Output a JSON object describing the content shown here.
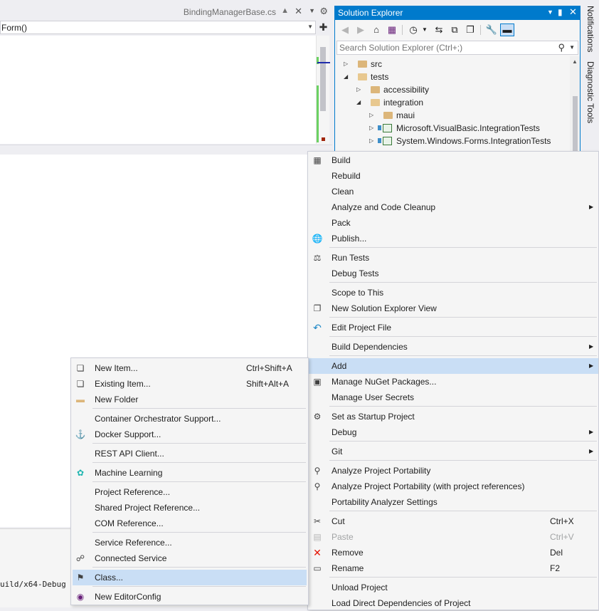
{
  "editor": {
    "tab_title": "BindingManagerBase.cs",
    "pin_icon": "pin-icon",
    "close_icon": "close-icon",
    "nav_member": "Form()",
    "output_path": "uild/x64-Debug"
  },
  "solution_explorer": {
    "title": "Solution Explorer",
    "search_placeholder": "Search Solution Explorer (Ctrl+;)",
    "tree": [
      {
        "label": "src",
        "indent": 0,
        "expanded": false,
        "kind": "folder"
      },
      {
        "label": "tests",
        "indent": 0,
        "expanded": true,
        "kind": "folder"
      },
      {
        "label": "accessibility",
        "indent": 1,
        "expanded": false,
        "kind": "folder"
      },
      {
        "label": "integration",
        "indent": 1,
        "expanded": true,
        "kind": "folder"
      },
      {
        "label": "maui",
        "indent": 2,
        "expanded": false,
        "kind": "folder"
      },
      {
        "label": "Microsoft.VisualBasic.IntegrationTests",
        "indent": 2,
        "expanded": false,
        "kind": "project"
      },
      {
        "label": "System.Windows.Forms.IntegrationTests",
        "indent": 2,
        "expanded": false,
        "kind": "project"
      }
    ]
  },
  "side_tabs": [
    "Notifications",
    "Diagnostic Tools"
  ],
  "context_menu": {
    "build": "Build",
    "rebuild": "Rebuild",
    "clean": "Clean",
    "analyze_cleanup": "Analyze and Code Cleanup",
    "pack": "Pack",
    "publish": "Publish...",
    "run_tests": "Run Tests",
    "debug_tests": "Debug Tests",
    "scope_to_this": "Scope to This",
    "new_se_view": "New Solution Explorer View",
    "edit_project_file": "Edit Project File",
    "build_dependencies": "Build Dependencies",
    "add": "Add",
    "manage_nuget": "Manage NuGet Packages...",
    "manage_secrets": "Manage User Secrets",
    "set_startup": "Set as Startup Project",
    "debug": "Debug",
    "git": "Git",
    "analyze_portability": "Analyze Project Portability",
    "analyze_portability_refs": "Analyze Project Portability (with project references)",
    "portability_settings": "Portability Analyzer Settings",
    "cut": "Cut",
    "cut_shortcut": "Ctrl+X",
    "paste": "Paste",
    "paste_shortcut": "Ctrl+V",
    "remove": "Remove",
    "remove_shortcut": "Del",
    "rename": "Rename",
    "rename_shortcut": "F2",
    "unload_project": "Unload Project",
    "load_direct_deps": "Load Direct Dependencies of Project"
  },
  "add_submenu": {
    "new_item": "New Item...",
    "new_item_shortcut": "Ctrl+Shift+A",
    "existing_item": "Existing Item...",
    "existing_item_shortcut": "Shift+Alt+A",
    "new_folder": "New Folder",
    "container_orchestrator": "Container Orchestrator Support...",
    "docker_support": "Docker Support...",
    "rest_api_client": "REST API Client...",
    "machine_learning": "Machine Learning",
    "project_reference": "Project Reference...",
    "shared_project_reference": "Shared Project Reference...",
    "com_reference": "COM Reference...",
    "service_reference": "Service Reference...",
    "connected_service": "Connected Service",
    "class": "Class...",
    "new_editorconfig": "New EditorConfig"
  },
  "colors": {
    "accent": "#007acc",
    "menu_highlight": "#c9def5",
    "menu_bg": "#f5f5f5",
    "remove_icon": "#e51400"
  }
}
